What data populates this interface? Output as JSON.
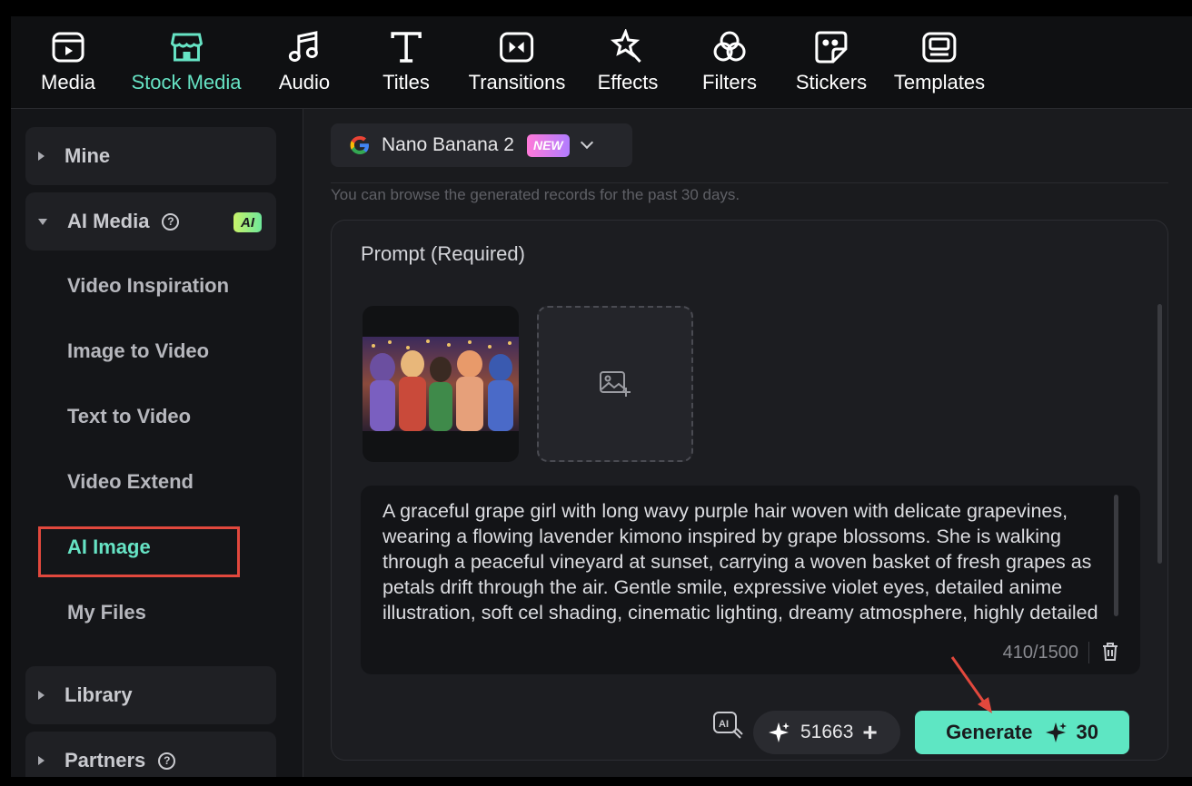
{
  "toolbar": {
    "items": [
      {
        "label": "Media",
        "icon": "media-icon",
        "active": false
      },
      {
        "label": "Stock Media",
        "icon": "stock-media-icon",
        "active": true
      },
      {
        "label": "Audio",
        "icon": "music-note-icon",
        "active": false
      },
      {
        "label": "Titles",
        "icon": "title-t-icon",
        "active": false
      },
      {
        "label": "Transitions",
        "icon": "transition-icon",
        "active": false
      },
      {
        "label": "Effects",
        "icon": "sparkle-star-icon",
        "active": false
      },
      {
        "label": "Filters",
        "icon": "filter-circles-icon",
        "active": false
      },
      {
        "label": "Stickers",
        "icon": "sticker-icon",
        "active": false
      },
      {
        "label": "Templates",
        "icon": "template-icon",
        "active": false
      }
    ]
  },
  "sidebar": {
    "groups": {
      "mine": "Mine",
      "ai_media": "AI Media",
      "ai_badge": "AI",
      "library": "Library",
      "partners": "Partners"
    },
    "help_glyph": "?",
    "ai_media_items": [
      {
        "label": "Video Inspiration",
        "active": false
      },
      {
        "label": "Image to Video",
        "active": false
      },
      {
        "label": "Text to Video",
        "active": false
      },
      {
        "label": "Video Extend",
        "active": false
      },
      {
        "label": "AI Image",
        "active": true
      },
      {
        "label": "My Files",
        "active": false
      }
    ]
  },
  "main": {
    "model": {
      "name": "Nano Banana 2",
      "badge": "NEW"
    },
    "hint": "You can browse the generated records for the past 30 days.",
    "prompt_label": "Prompt (Required)",
    "prompt_text": "A graceful grape girl with long wavy purple hair woven with delicate grapevines, wearing a flowing lavender kimono inspired by grape blossoms. She is walking through a peaceful vineyard at sunset, carrying a woven basket of fresh grapes as petals drift through the air. Gentle smile, expressive violet eyes, detailed anime illustration, soft cel shading, cinematic lighting, dreamy atmosphere, highly detailed",
    "char_count": "410/1500",
    "credits": "51663",
    "credits_plus": "+",
    "generate_label": "Generate",
    "generate_cost": "30"
  },
  "colors": {
    "accent": "#66e3c4",
    "generate_bg": "#5ee6c3",
    "highlight_box": "#e2483d",
    "new_badge": "#d17cff"
  }
}
